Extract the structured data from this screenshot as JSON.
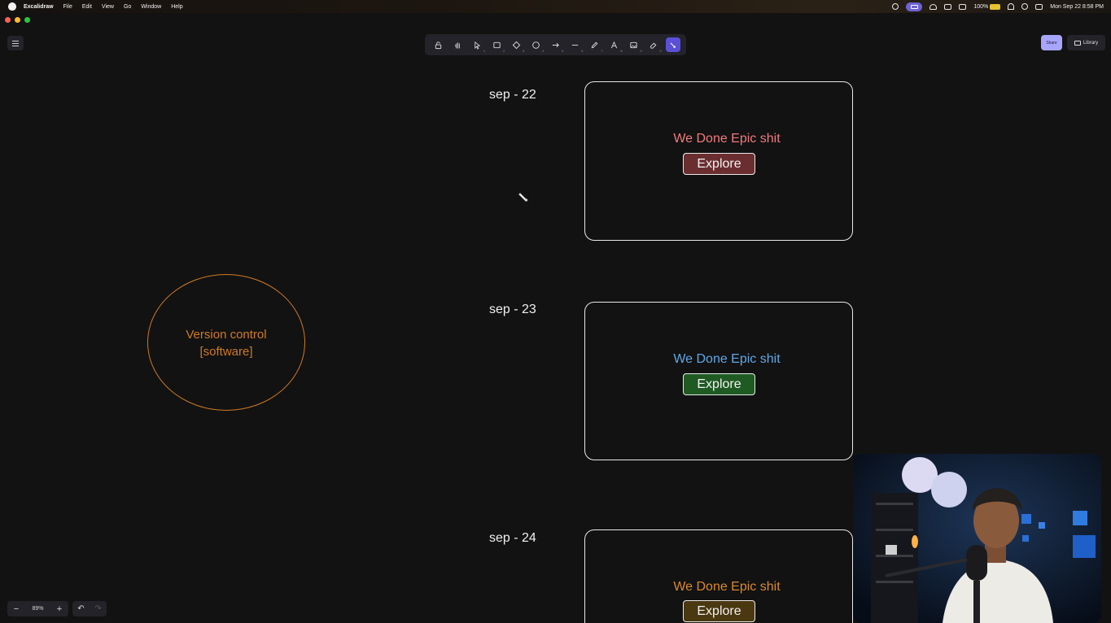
{
  "menubar": {
    "app_name": "Excalidraw",
    "menus": [
      "File",
      "Edit",
      "View",
      "Go",
      "Window",
      "Help"
    ],
    "battery": "100%",
    "datetime": "Mon Sep 22  8:58 PM"
  },
  "toolbar": {
    "tools": [
      {
        "name": "lock",
        "key": ""
      },
      {
        "name": "hand",
        "key": ""
      },
      {
        "name": "selection",
        "key": "1"
      },
      {
        "name": "rectangle",
        "key": "2"
      },
      {
        "name": "diamond",
        "key": "3"
      },
      {
        "name": "ellipse",
        "key": "4"
      },
      {
        "name": "arrow",
        "key": "5"
      },
      {
        "name": "line",
        "key": "6"
      },
      {
        "name": "draw",
        "key": "7"
      },
      {
        "name": "text",
        "key": "8"
      },
      {
        "name": "image",
        "key": "9"
      },
      {
        "name": "eraser",
        "key": "0"
      },
      {
        "name": "laser",
        "key": ""
      }
    ],
    "active_tool": "laser"
  },
  "header": {
    "share_label": "Share",
    "library_label": "Library"
  },
  "canvas": {
    "dates": [
      "sep - 22",
      "sep - 23",
      "sep - 24"
    ],
    "cards": [
      {
        "title": "We Done Epic shit",
        "title_color": "#f27a7d",
        "button_label": "Explore",
        "button_color": "#6b2e30"
      },
      {
        "title": "We Done Epic shit",
        "title_color": "#5fa7e8",
        "button_label": "Explore",
        "button_color": "#1f5a23"
      },
      {
        "title": "We Done Epic shit",
        "title_color": "#d9892d",
        "button_label": "Explore",
        "button_color": "#4a3810"
      }
    ],
    "ellipse_text": {
      "line1": "Version control",
      "line2": "[software]",
      "color": "#d07a22"
    }
  },
  "footer": {
    "zoom_out": "−",
    "zoom_level": "89%",
    "zoom_in": "+",
    "undo": "↶",
    "redo": "↷"
  },
  "colors": {
    "canvas_bg": "#121212",
    "toolbar_bg": "#232329",
    "accent": "#a8a5ff",
    "active_tool": "#5b4fd8"
  }
}
